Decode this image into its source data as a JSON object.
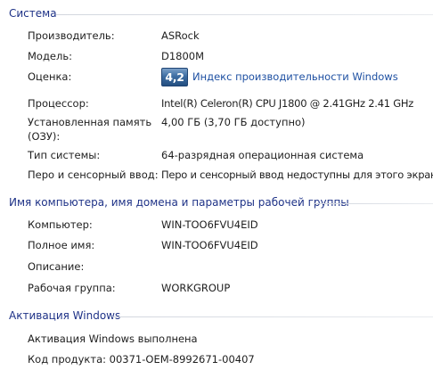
{
  "system": {
    "title": "Система",
    "manufacturer_label": "Производитель:",
    "manufacturer_value": "ASRock",
    "model_label": "Модель:",
    "model_value": "D1800M",
    "rating_label": "Оценка:",
    "rating_score": "4,2",
    "rating_link": "Индекс производительности Windows",
    "processor_label": "Процессор:",
    "processor_value": "Intel(R) Celeron(R) CPU  J1800  @ 2.41GHz   2.41 GHz",
    "memory_label_line1": "Установленная память",
    "memory_label_line2": "(ОЗУ):",
    "memory_value": "4,00 ГБ (3,70 ГБ доступно)",
    "system_type_label": "Тип системы:",
    "system_type_value": "64-разрядная операционная система",
    "pen_touch_label": "Перо и сенсорный ввод:",
    "pen_touch_value": "Перо и сенсорный ввод недоступны для этого экрана"
  },
  "computer": {
    "title": "Имя компьютера, имя домена и параметры рабочей группы",
    "computer_label": "Компьютер:",
    "computer_value": "WIN-TOO6FVU4EID",
    "fullname_label": "Полное имя:",
    "fullname_value": "WIN-TOO6FVU4EID",
    "description_label": "Описание:",
    "workgroup_label": "Рабочая группа:",
    "workgroup_value": "WORKGROUP"
  },
  "activation": {
    "title": "Активация Windows",
    "status": "Активация Windows выполнена",
    "product_key_label": "Код продукта:",
    "product_key_value": "00371-OEM-8992671-00407"
  },
  "colors": {
    "section_title": "#1e3287",
    "link": "#1e50a2",
    "badge": "#3e6ea3"
  }
}
